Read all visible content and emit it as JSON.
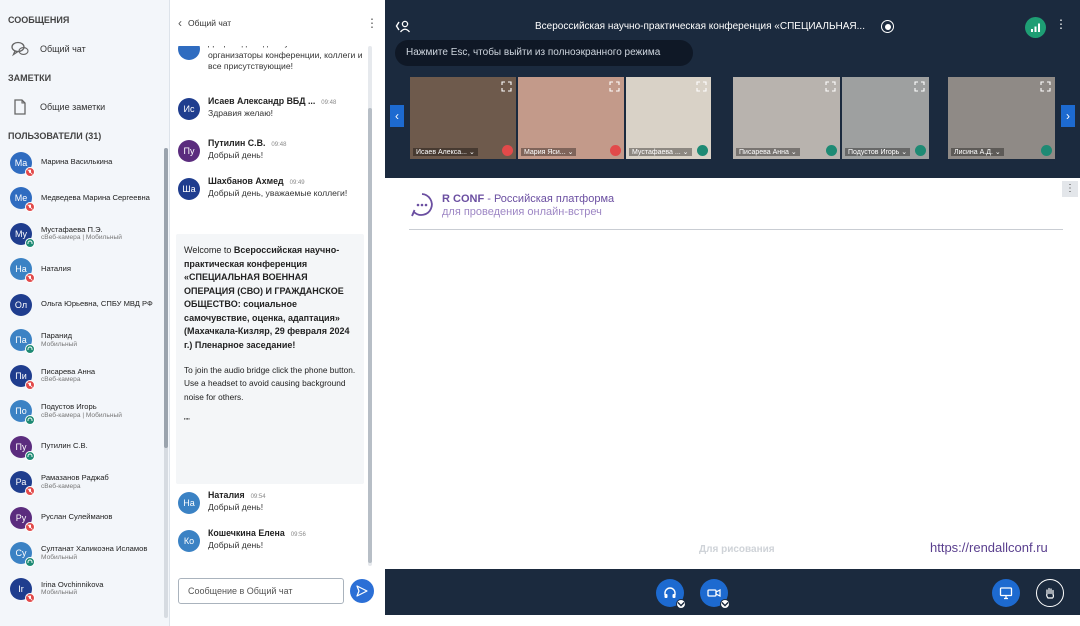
{
  "sidebar": {
    "messages_title": "СООБЩЕНИЯ",
    "public_chat": "Общий чат",
    "notes_title": "ЗАМЕТКИ",
    "shared_notes": "Общие заметки",
    "users_title": "ПОЛЬЗОВАТЕЛИ (31)",
    "users": [
      {
        "initials": "Ма",
        "name": "Марина Василькина",
        "sub": "",
        "color": "#2f6cc0",
        "status": "red"
      },
      {
        "initials": "Ме",
        "name": "Медведева Марина Сергеевна",
        "sub": "",
        "color": "#2f6cc0",
        "status": "red"
      },
      {
        "initials": "Му",
        "name": "Мустафаева П.Э.",
        "sub": "сВеб-камера | Мобильный",
        "color": "#1f3d8e",
        "status": "teal"
      },
      {
        "initials": "На",
        "name": "Наталия",
        "sub": "",
        "color": "#3b82c4",
        "status": "red"
      },
      {
        "initials": "Ол",
        "name": "Ольга Юрьевна, СПБУ МВД РФ",
        "sub": "",
        "color": "#1f3d8e",
        "status": ""
      },
      {
        "initials": "Па",
        "name": "Паранид",
        "sub": "Мобильный",
        "color": "#3b82c4",
        "status": "teal"
      },
      {
        "initials": "Пи",
        "name": "Писарева Анна",
        "sub": "сВеб-камера",
        "color": "#1f3d8e",
        "status": "red"
      },
      {
        "initials": "По",
        "name": "Подустов Игорь",
        "sub": "сВеб-камера | Мобильный",
        "color": "#3b82c4",
        "status": "teal"
      },
      {
        "initials": "Пу",
        "name": "Путилин С.В.",
        "sub": "",
        "color": "#5b2c7e",
        "status": "teal"
      },
      {
        "initials": "Ра",
        "name": "Рамазанов Раджаб",
        "sub": "сВеб-камера",
        "color": "#1f3d8e",
        "status": "red"
      },
      {
        "initials": "Ру",
        "name": "Руслан Сулейманов",
        "sub": "",
        "color": "#5b2c7e",
        "status": "red"
      },
      {
        "initials": "Су",
        "name": "Султанат Халикоэна Исламов",
        "sub": "Мобильный",
        "color": "#3b82c4",
        "status": "teal"
      },
      {
        "initials": "Ir",
        "name": "Irina Ovchinnikova",
        "sub": "Мобильный",
        "color": "#1f3d8e",
        "status": "red"
      }
    ]
  },
  "chat": {
    "title": "Общий чат",
    "messages": [
      {
        "initials": "",
        "name": "",
        "time": "",
        "color": "#2f6cc0",
        "text": "Добрый день день уважаемые организаторы конференции, коллеги и все присутствующие!"
      },
      {
        "initials": "Ис",
        "name": "Исаев Александр ВБД ...",
        "time": "09:48",
        "color": "#1f3d8e",
        "text": "Здравия желаю!"
      },
      {
        "initials": "Пу",
        "name": "Путилин С.В.",
        "time": "09:48",
        "color": "#5b2c7e",
        "text": "Добрый день!"
      },
      {
        "initials": "Ша",
        "name": "Шахбанов Ахмед",
        "time": "09:49",
        "color": "#1f3d8e",
        "text": "Добрый день, уважаемые коллеги!"
      },
      {
        "initials": "На",
        "name": "Наталия",
        "time": "09:54",
        "color": "#3b82c4",
        "text": "Добрый день!"
      },
      {
        "initials": "Ко",
        "name": "Кошечкина Елена",
        "time": "09:56",
        "color": "#3b82c4",
        "text": "Добрый день!"
      }
    ],
    "welcome_prefix": "Welcome to ",
    "welcome_bold": "Всероссийская научно-практическая конференция «СПЕЦИАЛЬНАЯ ВОЕННАЯ ОПЕРАЦИЯ (СВО) И ГРАЖДАНСКОЕ ОБЩЕСТВО: социальное самочувствие, оценка, адаптация» (Махачкала-Кизляр, 29 февраля 2024 г.) Пленарное заседание!",
    "welcome_join": "To join the audio bridge click the phone button. Use a headset to avoid causing background noise for others.",
    "welcome_quotes": "\"\"",
    "input_placeholder": "Сообщение в Общий чат"
  },
  "meeting": {
    "title": "Всероссийская научно-практическая конференция «СПЕЦИАЛЬНАЯ...",
    "esc_tip": "Нажмите Esc, чтобы выйти из полноэкранного режима",
    "tiles": [
      {
        "label": "Исаев Алекса... ⌄",
        "mic": "red",
        "bg": "#6e5a4c"
      },
      {
        "label": "Мария Яси... ⌄",
        "mic": "red",
        "bg": "#c39a8a"
      },
      {
        "label": "Мустафаева ... ⌄",
        "mic": "teal",
        "bg": "#d9d2c7"
      },
      {
        "label": "Писарева Анна ⌄",
        "mic": "teal",
        "bg": "#b8b3ae"
      },
      {
        "label": "Подустов Игорь ⌄",
        "mic": "teal",
        "bg": "#9ea0a0"
      },
      {
        "label": "Лисина А.Д. ⌄",
        "mic": "teal",
        "bg": "#8f8a86"
      }
    ],
    "brand_name": "R CONF",
    "brand_tail": " - Российская платформа",
    "brand_sub": "для проведения онлайн-встреч",
    "draw_label": "Для рисования",
    "url": "https://rendallconf.ru",
    "accent": "#1d6ad0"
  }
}
